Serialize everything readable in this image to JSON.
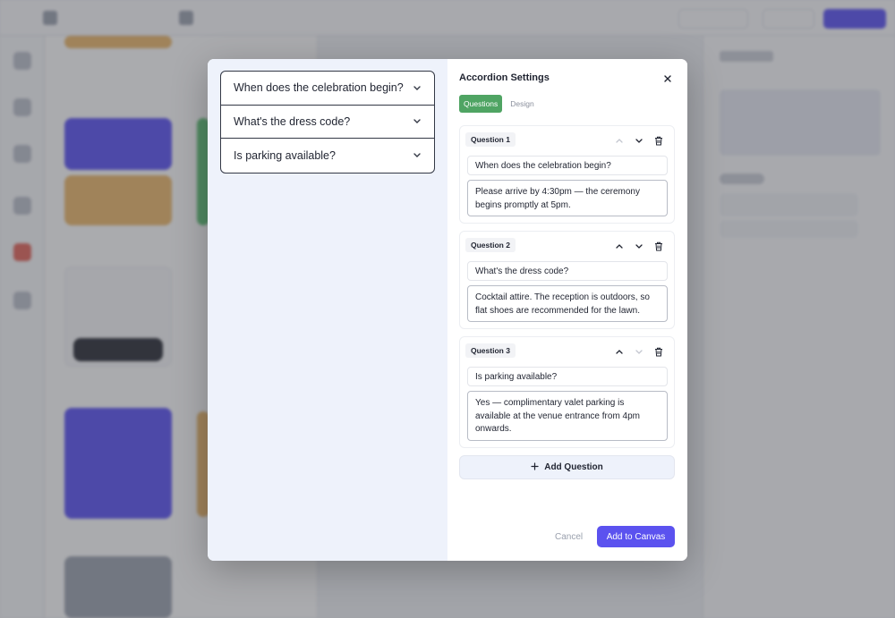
{
  "modal": {
    "preview_questions": [
      "When does the celebration begin?",
      "What's the dress code?",
      "Is parking available?"
    ],
    "title": "Accordion Settings",
    "tabs": [
      "Questions",
      "Design"
    ],
    "questions": [
      {
        "label": "Question 1",
        "question": "When does the celebration begin?",
        "answer": "Please arrive by 4:30pm — the ceremony begins promptly at 5pm."
      },
      {
        "label": "Question 2",
        "question": "What's the dress code?",
        "answer": "Cocktail attire. The reception is outdoors, so flat shoes are recommended for the lawn."
      },
      {
        "label": "Question 3",
        "question": "Is parking available?",
        "answer": "Yes — complimentary valet parking is available at the venue entrance from 4pm onwards."
      }
    ],
    "add_question": "Add Question",
    "cancel": "Cancel",
    "add_to_canvas": "Add to Canvas"
  },
  "colors": {
    "accent": "#5b52ef",
    "tab_active": "#4fa463",
    "preview_bg": "#eef2fb"
  },
  "icons": {
    "close": "close-icon",
    "chevron": "chevron-down-icon",
    "up": "arrow-up-icon",
    "down": "arrow-down-icon",
    "delete": "trash-icon",
    "add": "plus-icon"
  }
}
